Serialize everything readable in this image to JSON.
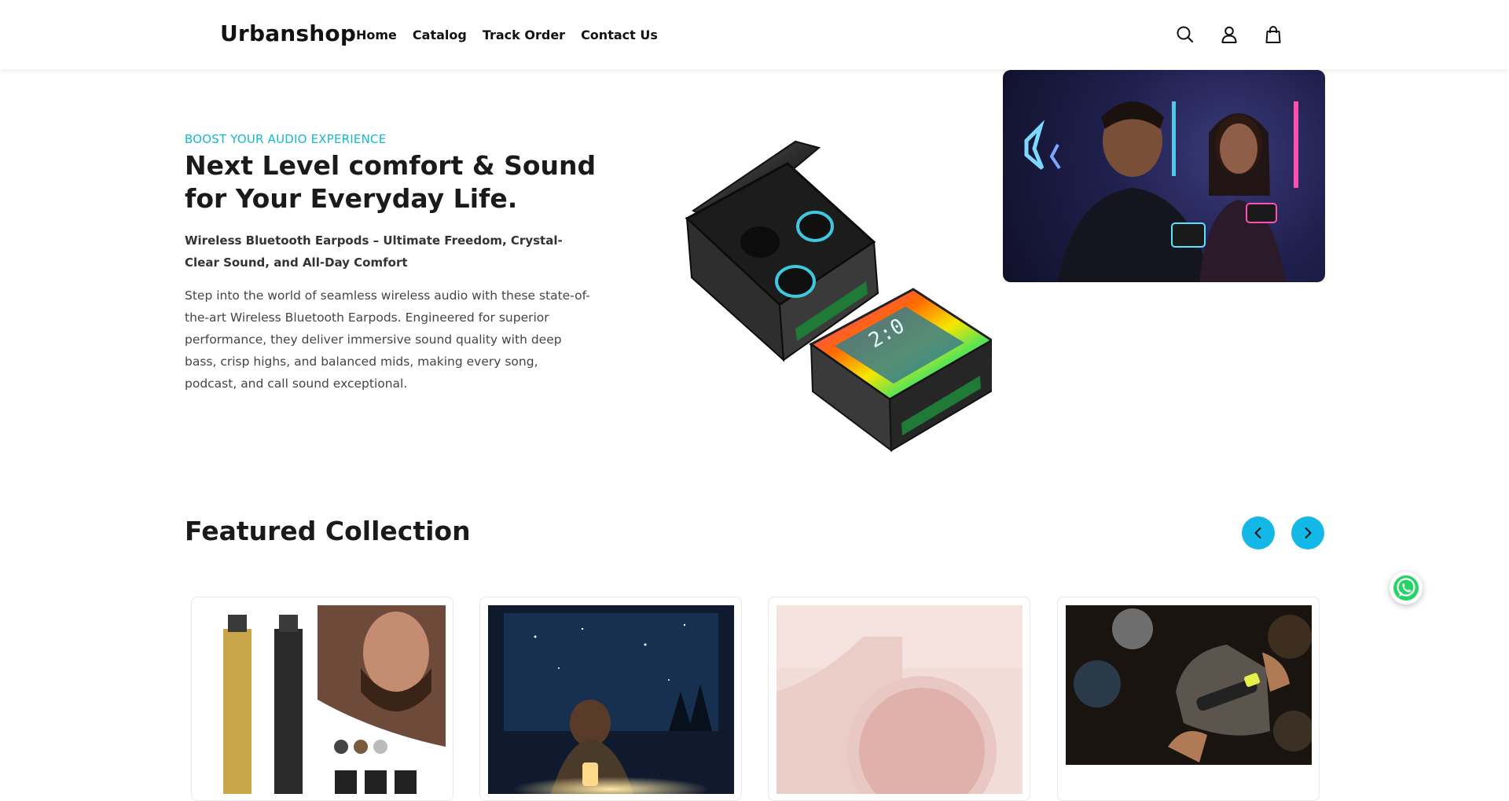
{
  "header": {
    "logo": "Urbanshop",
    "nav": [
      {
        "label": "Home"
      },
      {
        "label": "Catalog"
      },
      {
        "label": "Track Order"
      },
      {
        "label": "Contact Us"
      }
    ],
    "icons": [
      "search-icon",
      "account-icon",
      "cart-icon"
    ]
  },
  "hero": {
    "eyebrow": "BOOST YOUR AUDIO EXPERIENCE",
    "title": "Next Level comfort & Sound for Your Everyday Life.",
    "subtitle": "Wireless Bluetooth Earpods – Ultimate Freedom, Crystal-Clear Sound, and All-Day Comfort",
    "body": "Step into the world of seamless wireless audio with these state-of-the-art Wireless Bluetooth Earpods. Engineered for superior performance, they deliver immersive sound quality with deep bass, crisp highs, and balanced mids, making every song, podcast, and call sound exceptional."
  },
  "featured": {
    "title": "Featured Collection",
    "cards": [
      {
        "image": "trimmer-product-image"
      },
      {
        "image": "lantern-product-image"
      },
      {
        "image": "pink-product-image"
      },
      {
        "image": "flashlight-product-image"
      }
    ]
  },
  "colors": {
    "accent": "#14b8e6",
    "eyebrow": "#14b8d6",
    "whatsapp": "#25d366"
  }
}
